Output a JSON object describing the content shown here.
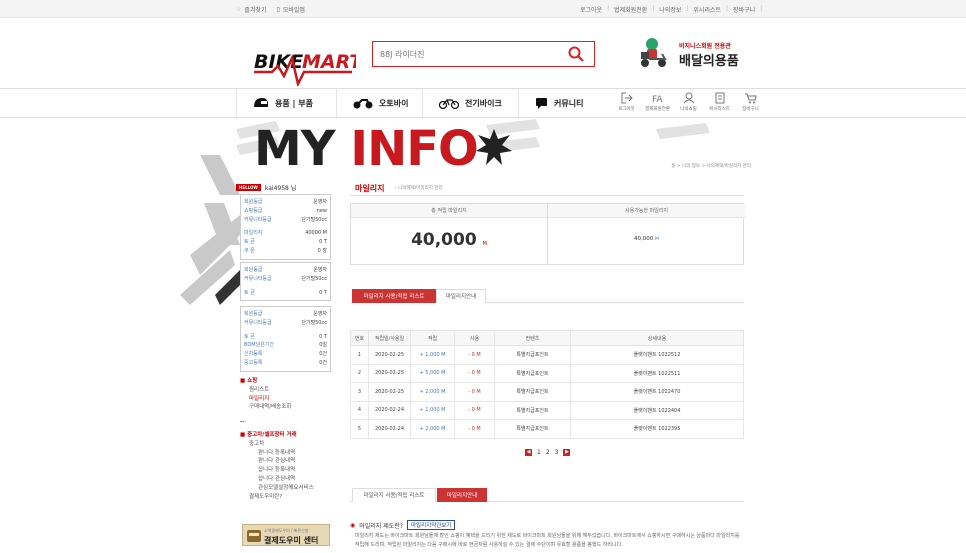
{
  "topbar": {
    "left": [
      "즐겨찾기",
      "모바일앱"
    ],
    "right": [
      "로그아웃",
      "법제회원전환",
      "나의정보",
      "위시리스트",
      "장바구니"
    ]
  },
  "search": {
    "placeholder": "88J 라이더진"
  },
  "promo": {
    "line1": "비지니스회원 전용관",
    "line2": "배달의용품"
  },
  "nav": {
    "items": [
      "용품 | 부품",
      "오토바이",
      "전기바이크",
      "커뮤니티"
    ],
    "icons": [
      "로그아웃",
      "결제회원전환",
      "나의쇼핑",
      "위시리스트",
      "장바구니"
    ]
  },
  "banner": {
    "title_a": "MY ",
    "title_b": "INFO",
    "breadcrumb": "홈 > 나의 정보 > 나의혜택/마일리지 관리"
  },
  "sidebar": {
    "hello_tag": "HELLOW",
    "user": "kai4958 님",
    "box1": [
      {
        "k": "회원등급",
        "v": "운영자"
      },
      {
        "k": "쇼핑등급",
        "v": "new"
      },
      {
        "k": "커뮤니티등급",
        "v": "단기털50cc"
      },
      {
        "k": "마일리지",
        "v": "40000 M"
      },
      {
        "k": "토 큰",
        "v": "0 T"
      },
      {
        "k": "쿠 폰",
        "v": "0 장"
      }
    ],
    "box2": [
      {
        "k": "회원등급",
        "v": "운영자"
      },
      {
        "k": "커뮤니티등급",
        "v": "단기털50cc"
      },
      {
        "k": "토 큰",
        "v": "0 T"
      }
    ],
    "box3": [
      {
        "k": "회원등급",
        "v": "운영자"
      },
      {
        "k": "커뮤니티등급",
        "v": "단기털50cc"
      },
      {
        "k": "토 큰",
        "v": "0 T"
      },
      {
        "k": "BOM남은기간",
        "v": "0일"
      },
      {
        "k": "신차등록",
        "v": "0건"
      },
      {
        "k": "중고등록",
        "v": "0건"
      }
    ],
    "menu_shop": "쇼핑",
    "menu_shop_items": [
      "찜리스트",
      "마일리지",
      "구매내역/배송조회"
    ],
    "menu_dash": "--",
    "menu_used": "중고차/셀프장터 거래",
    "menu_used_items": [
      "중고차",
      "판니다 등록내역",
      "판니다 관심내역",
      "삽니다 등록내역",
      "삽니다 관심내역",
      "관심모델설정해요서비스",
      "결제도우미란?"
    ],
    "cs_small": "소액결제도우미 / 빠른신청",
    "cs_big": "결제도우미 센터"
  },
  "main": {
    "title": "마일리지",
    "subtitle": "나의혜택/마일리지 관리",
    "summary": {
      "h1": "총 적립 마일리지",
      "h2": "사용가능한 마일리지",
      "total": "40,000",
      "total_unit": "M",
      "avail": "40,000",
      "avail_unit": "M"
    },
    "tabs1": [
      "마일리지 사용/적립 리스트",
      "마일리지안내"
    ],
    "table": {
      "headers": [
        "번호",
        "적립일/사용일",
        "적립",
        "사용",
        "컨텐츠",
        "상세내용"
      ],
      "rows": [
        [
          "1",
          "2020-02-25",
          "+ 1,000 M",
          "- 0 M",
          "특별지급포인트",
          "플랫이벤트 1022512"
        ],
        [
          "2",
          "2020-02-25",
          "+ 5,000 M",
          "- 0 M",
          "특별지급포인트",
          "플랫이벤트 1022511"
        ],
        [
          "3",
          "2020-02-25",
          "+ 2,000 M",
          "- 0 M",
          "특별지급포인트",
          "플랫이벤트 1022470"
        ],
        [
          "4",
          "2020-02-24",
          "+ 1,000 M",
          "- 0 M",
          "특별지급포인트",
          "플랫이벤트 1022404"
        ],
        [
          "5",
          "2020-02-24",
          "+ 2,000 M",
          "- 0 M",
          "특별지급포인트",
          "플랫이벤트 1022395"
        ]
      ]
    },
    "pages": [
      "1",
      "2",
      "3"
    ],
    "tabs2": [
      "마일리지 사용/적립 리스트",
      "마일리지안내"
    ],
    "q_title": "마일리지 제도란?",
    "q_link": "마일리지약관보기",
    "para": "마일리지 제도는 바이크마트 회원님들께 할인 쇼핑이 혜택을 드리기 위한 제도로 바이크마트 회원님들을 위해 해두었습니다. 바이크마트에서 쇼핑하시면 구매하시는 상품마다 마일리지를 적립해 드리며, 적립된 마일리지는 다음 구매시에 바로 현금처럼 사용하실 수 있는 결제 수단이며 유효할 용품을 봉행드 하리니다."
  },
  "colors": {
    "accent": "#cc2222",
    "link": "#4a7ab5"
  }
}
